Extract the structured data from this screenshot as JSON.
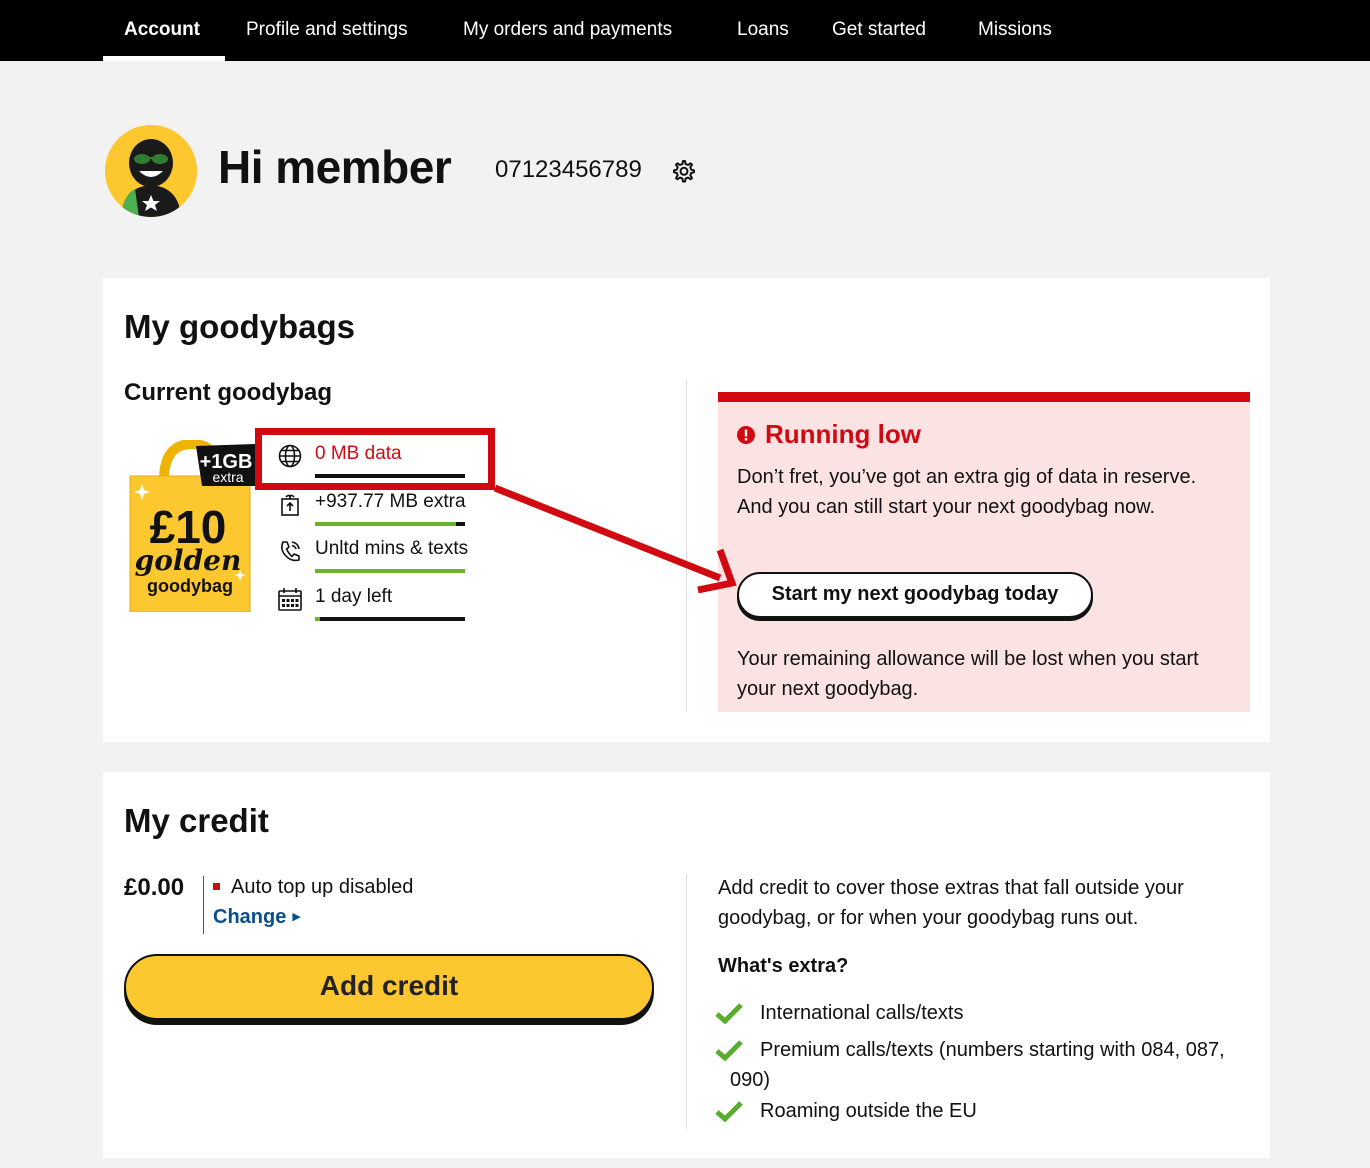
{
  "nav": {
    "tabs": [
      {
        "label": "Account",
        "active": true
      },
      {
        "label": "Profile and settings",
        "active": false
      },
      {
        "label": "My orders and payments",
        "active": false
      },
      {
        "label": "Loans",
        "active": false
      },
      {
        "label": "Get started",
        "active": false
      },
      {
        "label": "Missions",
        "active": false
      }
    ]
  },
  "header": {
    "greeting": "Hi member",
    "phone": "07123456789",
    "settings_icon": "gear-icon",
    "avatar_icon": "avatar-sunglasses-icon"
  },
  "goodybags": {
    "title": "My goodybags",
    "current_title": "Current goodybag",
    "bag": {
      "badge_top": "+1GB",
      "badge_bottom": "extra",
      "price": "£10",
      "line1": "golden",
      "line2": "goodybag"
    },
    "allowances": [
      {
        "icon": "globe-icon",
        "text": "0 MB data",
        "level": 0.0,
        "alert": true
      },
      {
        "icon": "gift-icon",
        "text": "+937.77 MB extra",
        "level": 0.94,
        "alert": false
      },
      {
        "icon": "phone-icon",
        "text": "Unltd mins & texts",
        "level": 1.0,
        "alert": false
      },
      {
        "icon": "calendar-icon",
        "text": "1 day left",
        "level": 0.03,
        "alert": false
      }
    ],
    "alert": {
      "title": "Running low",
      "body": "Don’t fret, you’ve got an extra gig of data in reserve. And you can still start your next goodybag now.",
      "button": "Start my next goodybag today",
      "footer": "Your remaining allowance will be lost when you start your next goodybag."
    }
  },
  "credit": {
    "title": "My credit",
    "amount": "£0.00",
    "topup_status": "Auto top up disabled",
    "change_label": "Change",
    "add_button": "Add credit",
    "description": "Add credit to cover those extras that fall outside your goodybag, or for when your goodybag runs out.",
    "extras_title": "What's extra?",
    "extras": [
      "International calls/texts",
      "Premium calls/texts (numbers starting with 084, 087, 090)",
      "Roaming outside the EU"
    ]
  },
  "colors": {
    "brand_yellow": "#fdc82f",
    "alert_red": "#d10a11",
    "alert_bg": "#fbe3e3",
    "progress_green": "#6ab42d",
    "link_blue": "#0b4f8a"
  }
}
